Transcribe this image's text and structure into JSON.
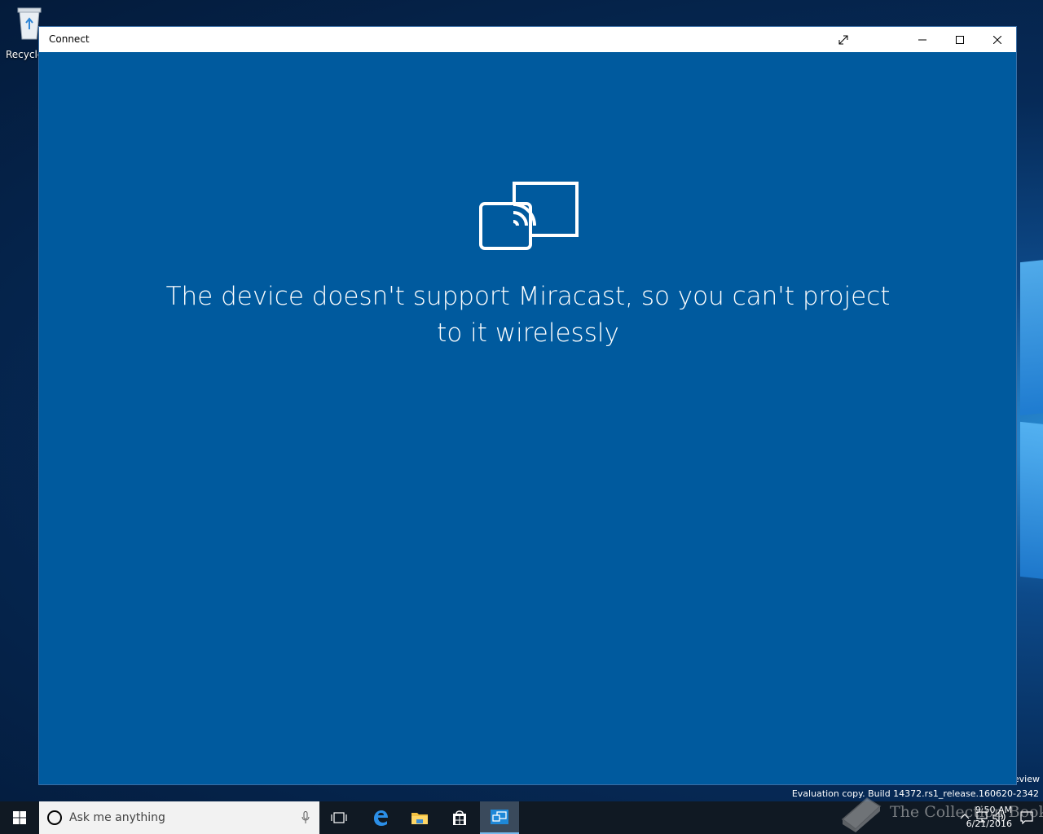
{
  "desktop": {
    "recycle_bin_label": "Recycle",
    "watermark_fragment": "eview",
    "eval_text": "Evaluation copy. Build 14372.rs1_release.160620-2342"
  },
  "window": {
    "title": "Connect",
    "message": "The device doesn't support Miracast, so you can't project to it wirelessly",
    "icon": "project-wireless-icon",
    "background_color": "#005a9e"
  },
  "taskbar": {
    "search_placeholder": "Ask me anything",
    "apps": [
      "task-view-icon",
      "edge-icon",
      "file-explorer-icon",
      "store-icon",
      "connect-app-icon"
    ],
    "clock": {
      "time": "9:50 AM",
      "date": "6/21/2016"
    }
  },
  "overlay": {
    "collection_text": "The Collection Book"
  }
}
